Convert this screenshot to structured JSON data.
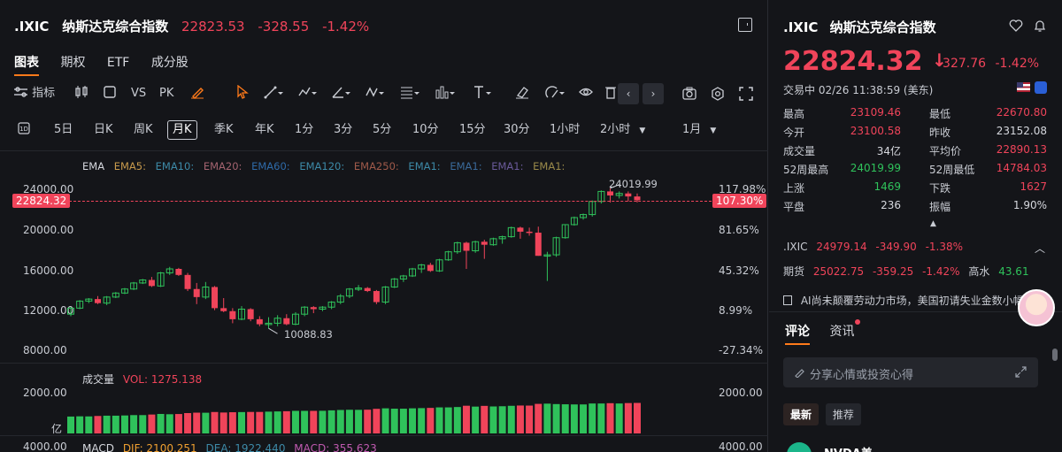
{
  "header": {
    "symbol": ".IXIC",
    "name": "纳斯达克综合指数",
    "price": "22823.53",
    "change": "-328.55",
    "change_pct": "-1.42%"
  },
  "tabs": [
    "图表",
    "期权",
    "ETF",
    "成分股"
  ],
  "toolbar": {
    "indicator_label": "指标",
    "vs_label": "VS",
    "pk_label": "PK"
  },
  "periods": {
    "items": [
      "5日",
      "日K",
      "周K",
      "月K",
      "季K",
      "年K",
      "1分",
      "3分",
      "5分",
      "10分",
      "15分",
      "30分",
      "1小时",
      "2小时"
    ],
    "active": "月K",
    "range": "1月"
  },
  "ema_row": [
    "EMA",
    "EMA5:",
    "EMA10:",
    "EMA20:",
    "EMA60:",
    "EMA120:",
    "EMA250:",
    "EMA1:",
    "EMA1:",
    "EMA1:",
    "EMA1:"
  ],
  "y_axis_left": [
    "24000.00",
    "20000.00",
    "16000.00",
    "12000.00",
    "8000.00"
  ],
  "y_axis_right": [
    "117.98%",
    "81.65%",
    "45.32%",
    "8.99%",
    "-27.34%"
  ],
  "current_price_tag": "22824.32",
  "current_pct_tag": "107.30%",
  "high_label": "24019.99",
  "low_label": "10088.83",
  "volume": {
    "title": "成交量",
    "vol_text": "VOL: 1275.138",
    "left_tick": "2000.00",
    "left_unit": "亿",
    "right_tick": "2000.00",
    "bottom_left": "4000.00",
    "bottom_right": "4000.00"
  },
  "macd": {
    "title": "MACD",
    "dif": "DIF: 2100.251",
    "dea": "DEA: 1922.440",
    "macd": "MACD: 355.623"
  },
  "chart_data": {
    "type": "candlestick",
    "title": "",
    "interval": "月K",
    "ylim": [
      8000,
      24500
    ],
    "candles": [
      {
        "o": 11500,
        "h": 12200,
        "l": 11300,
        "c": 12100
      },
      {
        "o": 12100,
        "h": 12900,
        "l": 12000,
        "c": 12800
      },
      {
        "o": 12800,
        "h": 13100,
        "l": 12600,
        "c": 13000
      },
      {
        "o": 13000,
        "h": 13300,
        "l": 12500,
        "c": 12600
      },
      {
        "o": 12600,
        "h": 13300,
        "l": 12400,
        "c": 13200
      },
      {
        "o": 13200,
        "h": 13700,
        "l": 13100,
        "c": 13600
      },
      {
        "o": 13600,
        "h": 14100,
        "l": 13500,
        "c": 14000
      },
      {
        "o": 14000,
        "h": 14700,
        "l": 13900,
        "c": 14600
      },
      {
        "o": 14600,
        "h": 15000,
        "l": 14500,
        "c": 14900
      },
      {
        "o": 14900,
        "h": 15200,
        "l": 14200,
        "c": 14300
      },
      {
        "o": 14300,
        "h": 15700,
        "l": 14200,
        "c": 15600
      },
      {
        "o": 15600,
        "h": 16200,
        "l": 15400,
        "c": 16000
      },
      {
        "o": 16000,
        "h": 16100,
        "l": 15300,
        "c": 15400
      },
      {
        "o": 15400,
        "h": 15600,
        "l": 13800,
        "c": 14000
      },
      {
        "o": 14000,
        "h": 14600,
        "l": 12500,
        "c": 13200
      },
      {
        "o": 13200,
        "h": 14700,
        "l": 13000,
        "c": 14200
      },
      {
        "o": 14200,
        "h": 14300,
        "l": 11900,
        "c": 12100
      },
      {
        "o": 12100,
        "h": 13100,
        "l": 11700,
        "c": 11800
      },
      {
        "o": 11800,
        "h": 12100,
        "l": 10600,
        "c": 11000
      },
      {
        "o": 11000,
        "h": 12300,
        "l": 10900,
        "c": 12000
      },
      {
        "o": 12000,
        "h": 12100,
        "l": 10800,
        "c": 11000
      },
      {
        "o": 11000,
        "h": 11300,
        "l": 10300,
        "c": 10500
      },
      {
        "o": 10500,
        "h": 11200,
        "l": 10089,
        "c": 10600
      },
      {
        "o": 10600,
        "h": 11400,
        "l": 10300,
        "c": 11100
      },
      {
        "o": 11100,
        "h": 11500,
        "l": 10400,
        "c": 10500
      },
      {
        "o": 10500,
        "h": 11700,
        "l": 10400,
        "c": 11500
      },
      {
        "o": 11500,
        "h": 12300,
        "l": 11300,
        "c": 12200
      },
      {
        "o": 12200,
        "h": 12300,
        "l": 11600,
        "c": 12000
      },
      {
        "o": 12000,
        "h": 12300,
        "l": 11800,
        "c": 12200
      },
      {
        "o": 12200,
        "h": 12800,
        "l": 12000,
        "c": 12700
      },
      {
        "o": 12700,
        "h": 13500,
        "l": 12500,
        "c": 13300
      },
      {
        "o": 13300,
        "h": 14100,
        "l": 13100,
        "c": 14000
      },
      {
        "o": 14000,
        "h": 14400,
        "l": 13800,
        "c": 14100
      },
      {
        "o": 14100,
        "h": 14200,
        "l": 13700,
        "c": 13800
      },
      {
        "o": 13800,
        "h": 13900,
        "l": 12500,
        "c": 12700
      },
      {
        "o": 12700,
        "h": 14300,
        "l": 12500,
        "c": 14200
      },
      {
        "o": 14200,
        "h": 15100,
        "l": 14100,
        "c": 15000
      },
      {
        "o": 15000,
        "h": 15400,
        "l": 14700,
        "c": 15300
      },
      {
        "o": 15300,
        "h": 16100,
        "l": 15200,
        "c": 16000
      },
      {
        "o": 16000,
        "h": 16500,
        "l": 15600,
        "c": 16400
      },
      {
        "o": 16400,
        "h": 16600,
        "l": 15700,
        "c": 15800
      },
      {
        "o": 15800,
        "h": 17000,
        "l": 15700,
        "c": 16900
      },
      {
        "o": 16900,
        "h": 17800,
        "l": 16800,
        "c": 17700
      },
      {
        "o": 17700,
        "h": 18700,
        "l": 17500,
        "c": 18600
      },
      {
        "o": 18600,
        "h": 18700,
        "l": 16000,
        "c": 17800
      },
      {
        "o": 17800,
        "h": 18800,
        "l": 17600,
        "c": 18700
      },
      {
        "o": 18700,
        "h": 18900,
        "l": 17000,
        "c": 18400
      },
      {
        "o": 18400,
        "h": 19100,
        "l": 18300,
        "c": 19000
      },
      {
        "o": 19000,
        "h": 19300,
        "l": 18500,
        "c": 19200
      },
      {
        "o": 19200,
        "h": 20200,
        "l": 19100,
        "c": 20100
      },
      {
        "o": 20100,
        "h": 20200,
        "l": 19000,
        "c": 19700
      },
      {
        "o": 19700,
        "h": 20100,
        "l": 19300,
        "c": 19600
      },
      {
        "o": 19600,
        "h": 20200,
        "l": 17300,
        "c": 17300
      },
      {
        "o": 17300,
        "h": 17700,
        "l": 14800,
        "c": 17400
      },
      {
        "o": 17400,
        "h": 19200,
        "l": 17200,
        "c": 19100
      },
      {
        "o": 19100,
        "h": 20400,
        "l": 19000,
        "c": 20400
      },
      {
        "o": 20400,
        "h": 21200,
        "l": 20300,
        "c": 21100
      },
      {
        "o": 21100,
        "h": 21500,
        "l": 20900,
        "c": 21400
      },
      {
        "o": 21400,
        "h": 22800,
        "l": 21200,
        "c": 22700
      },
      {
        "o": 22700,
        "h": 23800,
        "l": 22500,
        "c": 23700
      },
      {
        "o": 23700,
        "h": 24020,
        "l": 22600,
        "c": 23300
      },
      {
        "o": 23300,
        "h": 23700,
        "l": 23000,
        "c": 23500
      },
      {
        "o": 23500,
        "h": 23700,
        "l": 22700,
        "c": 23200
      },
      {
        "o": 23200,
        "h": 23500,
        "l": 22600,
        "c": 22824
      }
    ],
    "volume_ylim": [
      0,
      2600
    ]
  },
  "right_panel": {
    "title_symbol": ".IXIC",
    "title_name": "纳斯达克综合指数",
    "price": "22824.32",
    "change": "-327.76",
    "change_pct": "-1.42%",
    "status": "交易中 02/26 11:38:59 (美东)",
    "stats": [
      {
        "k": "最高",
        "v": "23109.46",
        "c": "red"
      },
      {
        "k": "最低",
        "v": "22670.80",
        "c": "red"
      },
      {
        "k": "今开",
        "v": "23100.58",
        "c": "red"
      },
      {
        "k": "昨收",
        "v": "23152.08",
        "c": "plain"
      },
      {
        "k": "成交量",
        "v": "34亿",
        "c": "plain"
      },
      {
        "k": "平均价",
        "v": "22890.13",
        "c": "red"
      },
      {
        "k": "52周最高",
        "v": "24019.99",
        "c": "green"
      },
      {
        "k": "52周最低",
        "v": "14784.03",
        "c": "red"
      },
      {
        "k": "上涨",
        "v": "1469",
        "c": "green"
      },
      {
        "k": "下跌",
        "v": "1627",
        "c": "red"
      },
      {
        "k": "平盘",
        "v": "236",
        "c": "plain"
      },
      {
        "k": "振幅",
        "v": "1.90%",
        "c": "plain"
      }
    ],
    "futures_row1": {
      "sym": ".IXIC",
      "price": "24979.14",
      "chg": "-349.90",
      "pct": "-1.38%"
    },
    "futures_row2": {
      "label": "期货",
      "price": "25022.75",
      "chg": "-359.25",
      "pct": "-1.42%",
      "extra_label": "高水",
      "extra": "43.61"
    },
    "news": "AI尚未颠覆劳动力市场，美国初请失业金数小幅升",
    "comment_tabs": [
      "评论",
      "资讯"
    ],
    "comment_placeholder": "分享心情或投资心得",
    "filters": [
      "最新",
      "推荐"
    ],
    "post_user": "NVDA美"
  },
  "colors": {
    "up": "#2fc25b",
    "down": "#f0445a",
    "accent": "#ff7a1a",
    "background": "#141519"
  }
}
